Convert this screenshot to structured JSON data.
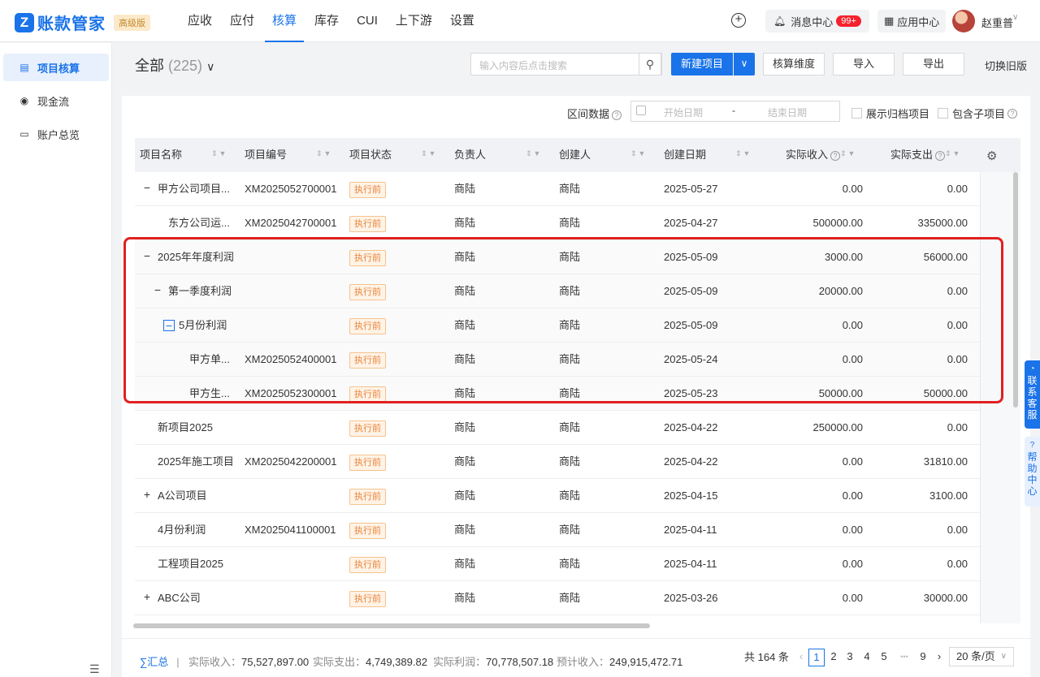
{
  "app": {
    "logo_letter": "Z",
    "name": "账款管家",
    "edition": "高级版"
  },
  "nav": [
    "应收",
    "应付",
    "核算",
    "库存",
    "CUI",
    "上下游",
    "设置"
  ],
  "nav_active": "核算",
  "top_right": {
    "plus": "+",
    "messages_label": "消息中心",
    "messages_badge": "99+",
    "apps_label": "应用中心",
    "username": "赵重普"
  },
  "sidebar": {
    "items": [
      {
        "label": "项目核算",
        "icon": "project-icon",
        "glyph": "▤",
        "active": true
      },
      {
        "label": "现金流",
        "icon": "cash-icon",
        "glyph": "◉",
        "active": false
      },
      {
        "label": "账户总览",
        "icon": "account-icon",
        "glyph": "▭",
        "active": false
      }
    ],
    "collapse": "☰"
  },
  "header": {
    "title": "全部",
    "count": "(225)",
    "chevron": "∨",
    "search_placeholder": "输入内容后点击搜索",
    "search_icon": "⚲",
    "new_btn": "新建项目",
    "new_drop": "∨",
    "btn_dimension": "核算维度",
    "btn_import": "导入",
    "btn_export": "导出",
    "switch_old": "切换旧版"
  },
  "filters": {
    "range_label": "区间数据",
    "start_placeholder": "开始日期",
    "sep": "-",
    "end_placeholder": "结束日期",
    "show_archived": "展示归档项目",
    "include_children": "包含子项目",
    "help": "?"
  },
  "table": {
    "columns": [
      "项目名称",
      "项目编号",
      "项目状态",
      "负责人",
      "创建人",
      "创建日期",
      "实际收入",
      "实际支出"
    ],
    "rows": [
      {
        "toggle": "−",
        "indent": 0,
        "name": "甲方公司项目...",
        "code": "XM2025052700001",
        "status": "执行前",
        "owner": "商陆",
        "creator": "商陆",
        "date": "2025-05-27",
        "income": "0.00",
        "expense": "0.00"
      },
      {
        "toggle": "",
        "indent": 1,
        "name": "东方公司运...",
        "code": "XM2025042700001",
        "status": "执行前",
        "owner": "商陆",
        "creator": "商陆",
        "date": "2025-04-27",
        "income": "500000.00",
        "expense": "335000.00"
      },
      {
        "toggle": "−",
        "indent": 0,
        "name": "2025年年度利润",
        "code": "",
        "status": "执行前",
        "owner": "商陆",
        "creator": "商陆",
        "date": "2025-05-09",
        "income": "3000.00",
        "expense": "56000.00"
      },
      {
        "toggle": "−",
        "indent": 1,
        "name": "第一季度利润",
        "code": "",
        "status": "执行前",
        "owner": "商陆",
        "creator": "商陆",
        "date": "2025-05-09",
        "income": "20000.00",
        "expense": "0.00"
      },
      {
        "toggle": "−",
        "indent": 2,
        "name": "5月份利润",
        "code": "",
        "status": "执行前",
        "owner": "商陆",
        "creator": "商陆",
        "date": "2025-05-09",
        "income": "0.00",
        "expense": "0.00"
      },
      {
        "toggle": "",
        "indent": 3,
        "name": "甲方单...",
        "code": "XM2025052400001",
        "status": "执行前",
        "owner": "商陆",
        "creator": "商陆",
        "date": "2025-05-24",
        "income": "0.00",
        "expense": "0.00"
      },
      {
        "toggle": "",
        "indent": 3,
        "name": "甲方生...",
        "code": "XM2025052300001",
        "status": "执行前",
        "owner": "商陆",
        "creator": "商陆",
        "date": "2025-05-23",
        "income": "50000.00",
        "expense": "50000.00"
      },
      {
        "toggle": "",
        "indent": 0,
        "name": "新项目2025",
        "code": "",
        "status": "执行前",
        "owner": "商陆",
        "creator": "商陆",
        "date": "2025-04-22",
        "income": "250000.00",
        "expense": "0.00"
      },
      {
        "toggle": "",
        "indent": 0,
        "name": "2025年施工项目",
        "code": "XM2025042200001",
        "status": "执行前",
        "owner": "商陆",
        "creator": "商陆",
        "date": "2025-04-22",
        "income": "0.00",
        "expense": "31810.00"
      },
      {
        "toggle": "+",
        "indent": 0,
        "name": "A公司项目",
        "code": "",
        "status": "执行前",
        "owner": "商陆",
        "creator": "商陆",
        "date": "2025-04-15",
        "income": "0.00",
        "expense": "3100.00"
      },
      {
        "toggle": "",
        "indent": 0,
        "name": "4月份利润",
        "code": "XM2025041100001",
        "status": "执行前",
        "owner": "商陆",
        "creator": "商陆",
        "date": "2025-04-11",
        "income": "0.00",
        "expense": "0.00"
      },
      {
        "toggle": "",
        "indent": 0,
        "name": "工程项目2025",
        "code": "",
        "status": "执行前",
        "owner": "商陆",
        "creator": "商陆",
        "date": "2025-04-11",
        "income": "0.00",
        "expense": "0.00"
      },
      {
        "toggle": "+",
        "indent": 0,
        "name": "ABC公司",
        "code": "",
        "status": "执行前",
        "owner": "商陆",
        "creator": "商陆",
        "date": "2025-03-26",
        "income": "0.00",
        "expense": "30000.00"
      }
    ]
  },
  "summary": {
    "label": "∑汇总",
    "divider": "|",
    "income_k": "实际收入：",
    "income_v": "75,527,897.00",
    "expense_k": "实际支出：",
    "expense_v": "4,749,389.82",
    "profit_k": "实际利润：",
    "profit_v": "70,778,507.18",
    "planned_k": "预计收入：",
    "planned_v": "249,915,472.71"
  },
  "pagination": {
    "total": "共 164 条",
    "prev": "‹",
    "pages": [
      "1",
      "2",
      "3",
      "4",
      "5"
    ],
    "ellipsis": "•••",
    "last": "9",
    "next": "›",
    "current": "1",
    "page_size": "20 条/页"
  },
  "float": {
    "support": "联系客服",
    "help": "帮助中心"
  },
  "colors": {
    "brand": "#1a73e8",
    "status_text": "#e8833a",
    "highlight": "#e02020"
  }
}
